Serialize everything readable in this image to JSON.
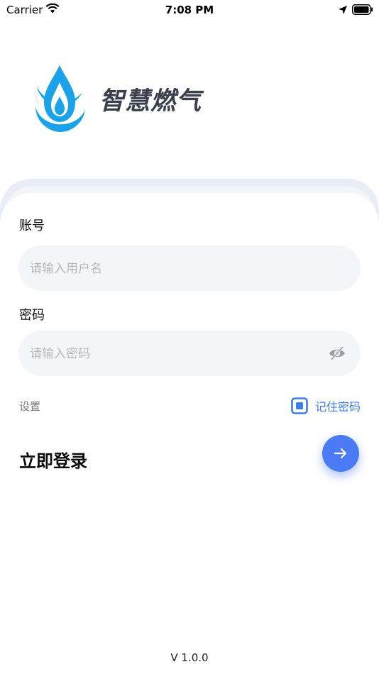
{
  "status_bar": {
    "carrier": "Carrier",
    "time": "7:08 PM"
  },
  "app": {
    "name": "智慧燃气"
  },
  "form": {
    "account_label": "账号",
    "account_placeholder": "请输入用户名",
    "password_label": "密码",
    "password_placeholder": "请输入密码"
  },
  "options": {
    "settings": "设置",
    "remember": "记住密码"
  },
  "login": {
    "title": "立即登录"
  },
  "footer": {
    "version": "V 1.0.0"
  },
  "colors": {
    "accent": "#4a7bf4",
    "logo_blue": "#1aa3e8",
    "link": "#3c7bf0"
  }
}
